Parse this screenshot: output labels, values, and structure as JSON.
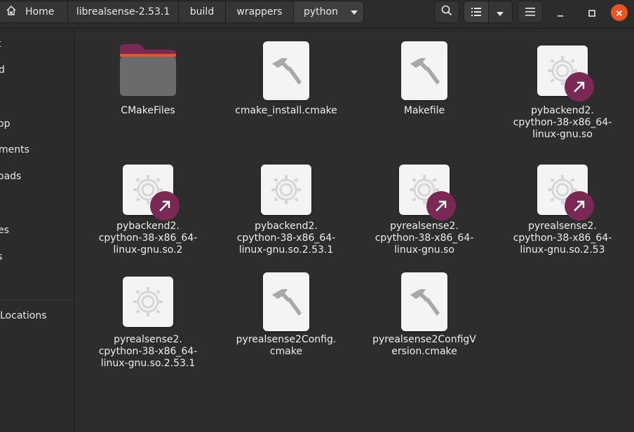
{
  "header": {
    "breadcrumbs": [
      "Home",
      "librealsense-2.53.1",
      "build",
      "wrappers",
      "python"
    ],
    "accent_color": "#e95420"
  },
  "sidebar": {
    "items": [
      "t",
      "d",
      "op",
      "ments",
      "oads",
      "es",
      "s",
      "Locations"
    ]
  },
  "files": [
    {
      "name": "CMakeFiles",
      "type": "folder"
    },
    {
      "name": "cmake_install.cmake",
      "type": "cmake"
    },
    {
      "name": "Makefile",
      "type": "cmake"
    },
    {
      "name": "pybackend2.\ncpython-38-x86_64-\nlinux-gnu.so",
      "type": "library-link"
    },
    {
      "name": "pybackend2.\ncpython-38-x86_64-\nlinux-gnu.so.2",
      "type": "library-link"
    },
    {
      "name": "pybackend2.\ncpython-38-x86_64-\nlinux-gnu.so.2.53.1",
      "type": "library"
    },
    {
      "name": "pyrealsense2.\ncpython-38-x86_64-\nlinux-gnu.so",
      "type": "library-link"
    },
    {
      "name": "pyrealsense2.\ncpython-38-x86_64-\nlinux-gnu.so.2.53",
      "type": "library-link"
    },
    {
      "name": "pyrealsense2.\ncpython-38-x86_64-\nlinux-gnu.so.2.53.1",
      "type": "library"
    },
    {
      "name": "pyrealsense2Config.\ncmake",
      "type": "cmake"
    },
    {
      "name": "pyrealsense2ConfigV\nersion.cmake",
      "type": "cmake"
    }
  ]
}
